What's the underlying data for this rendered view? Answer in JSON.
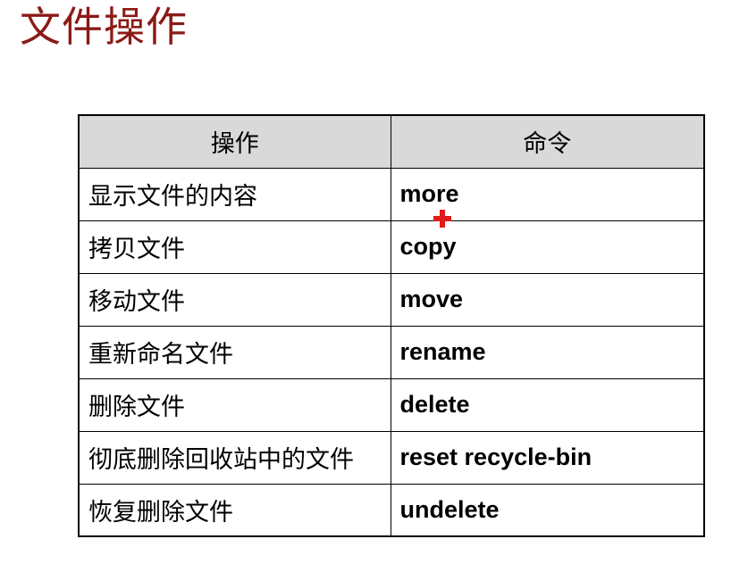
{
  "title": "文件操作",
  "table": {
    "headers": {
      "operation": "操作",
      "command": "命令"
    },
    "rows": [
      {
        "operation": "显示文件的内容",
        "command": "more"
      },
      {
        "operation": "拷贝文件",
        "command": "copy"
      },
      {
        "operation": "移动文件",
        "command": "move"
      },
      {
        "operation": "重新命名文件",
        "command": "rename"
      },
      {
        "operation": "删除文件",
        "command": "delete"
      },
      {
        "operation": "彻底删除回收站中的文件",
        "command": "reset recycle-bin"
      },
      {
        "operation": "恢复删除文件",
        "command": "undelete"
      }
    ]
  },
  "cursor": {
    "icon": "red-cross-cursor-icon",
    "color": "#e01b1b"
  },
  "colors": {
    "title": "#8b1a16",
    "header_bg": "#d9d9d9"
  }
}
